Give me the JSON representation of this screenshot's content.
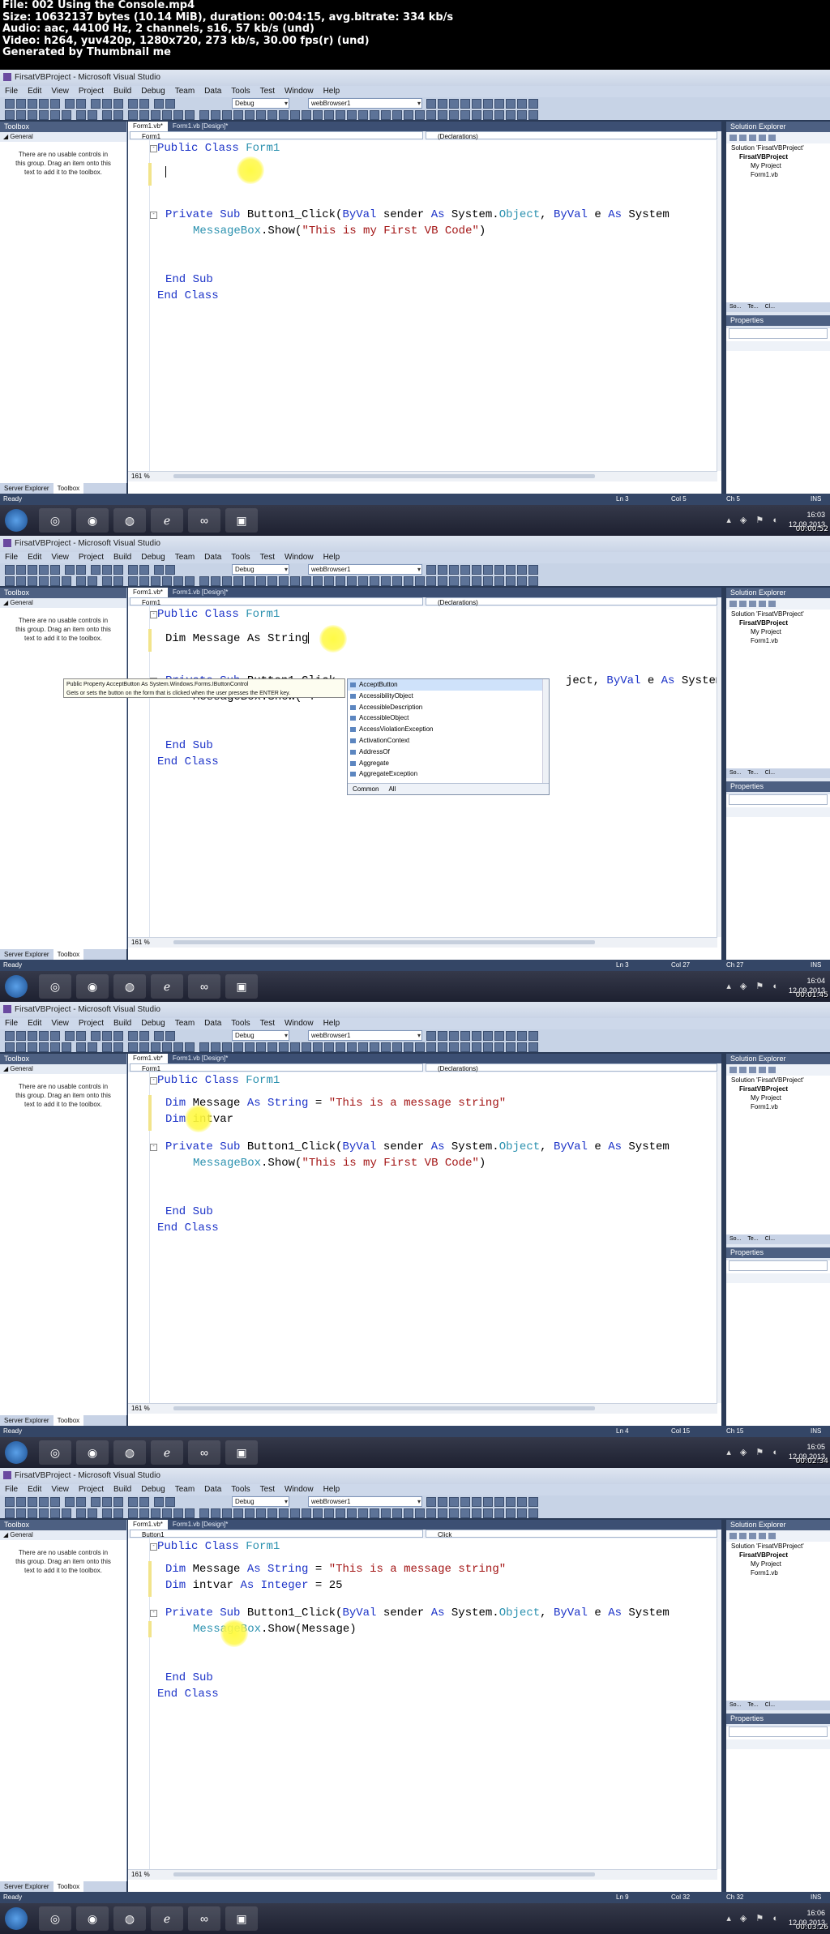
{
  "header": {
    "lines": [
      "File: 002 Using the Console.mp4",
      "Size: 10632137 bytes (10.14 MiB), duration: 00:04:15, avg.bitrate: 334 kb/s",
      "Audio: aac, 44100 Hz, 2 channels, s16, 57 kb/s (und)",
      "Video: h264, yuv420p, 1280x720, 273 kb/s, 30.00 fps(r) (und)",
      "Generated by Thumbnail me"
    ]
  },
  "common": {
    "window_title": "FirsatVBProject - Microsoft Visual Studio",
    "menu": [
      "File",
      "Edit",
      "View",
      "Project",
      "Build",
      "Debug",
      "Team",
      "Data",
      "Tools",
      "Test",
      "Window",
      "Help"
    ],
    "config_combo": "Debug",
    "target_combo": "webBrowser1",
    "toolbox_title": "Toolbox",
    "toolbox_group": "General",
    "toolbox_message": "There are no usable controls in this group. Drag an item onto this text to add it to the toolbox.",
    "server_explorer_tab": "Server Explorer",
    "toolbox_tab": "Toolbox",
    "tab_code": "Form1.vb*",
    "tab_design": "Form1.vb [Design]*",
    "solution_explorer_title": "Solution Explorer",
    "solution_node": "Solution 'FirsatVBProject'",
    "project_node": "FirsatVBProject",
    "my_project_node": "My Project",
    "form_node": "Form1.vb",
    "se_tabs": [
      "So...",
      "Te...",
      "Cl..."
    ],
    "properties_title": "Properties",
    "zoom": "161 %",
    "status_ready": "Ready",
    "ins": "INS",
    "date": "12.09.2013"
  },
  "frames": [
    {
      "nav_left": "Form1",
      "nav_right": "(Declarations)",
      "lines": {
        "l1": "Form1",
        "sub": "Button1_Click",
        "sub_args_a": "(",
        "sub_args_b": " sender ",
        "sub_args_c": " System.",
        "sub_args_d": ", ",
        "sub_args_e": " e ",
        "sub_args_f": " System",
        "msg_obj": "MessageBox",
        "msg_call": ".Show(",
        "msg_str": "\"This is my First VB Code\"",
        "msg_close": ")"
      },
      "status": {
        "ln": "Ln 3",
        "col": "Col 5",
        "ch": "Ch 5"
      },
      "clock": "16:03",
      "stamp": "00:00:52"
    },
    {
      "nav_left": "Form1",
      "nav_right": "(Declarations)",
      "typing": "Dim Message As String",
      "visible_call": "MessageBox.Show(\"T",
      "tooltip_line1": "Public Property AcceptButton As System.Windows.Forms.IButtonControl",
      "tooltip_line2": "Gets or sets the button on the form that is clicked when the user presses the ENTER key.",
      "completion": [
        "AcceptButton",
        "AccessibilityObject",
        "AccessibleDescription",
        "AccessibleObject",
        "AccessViolationException",
        "ActivationContext",
        "AddressOf",
        "Aggregate",
        "AggregateException"
      ],
      "completion_tabs": [
        "Common",
        "All"
      ],
      "visible_args": "ject, ",
      "status": {
        "ln": "Ln 3",
        "col": "Col 27",
        "ch": "Ch 27"
      },
      "clock": "16:04",
      "stamp": "00:01:45"
    },
    {
      "nav_left": "Form1",
      "nav_right": "(Declarations)",
      "dim_msg_str": "\"This is a message string\"",
      "dim_int": "intvar",
      "status": {
        "ln": "Ln 4",
        "col": "Col 15",
        "ch": "Ch 15"
      },
      "clock": "16:05",
      "stamp": "00:02:34"
    },
    {
      "nav_left": "Button1",
      "nav_right": "Click",
      "dim_int_value": "25",
      "msg_arg": "Message",
      "status": {
        "ln": "Ln 9",
        "col": "Col 32",
        "ch": "Ch 32"
      },
      "clock": "16:06",
      "stamp": "00:03:26"
    }
  ]
}
